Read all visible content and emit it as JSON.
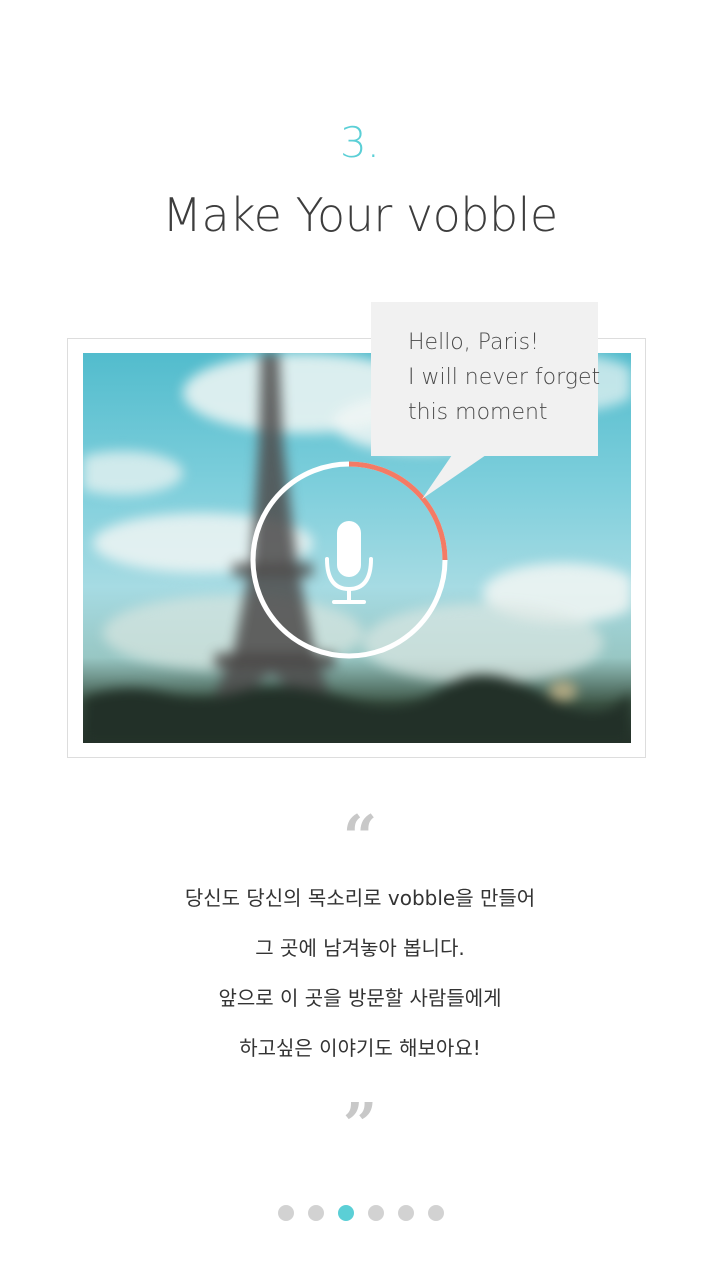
{
  "step": {
    "number": "3.",
    "title": "Make Your vobble"
  },
  "bubble": {
    "lines": [
      "Hello, Paris!",
      "I will never forget",
      "this moment"
    ]
  },
  "recorder": {
    "icon": "microphone-icon",
    "progress": 0.25,
    "progress_color": "#f47b65",
    "track_color": "#ffffff"
  },
  "quote": {
    "open": "“",
    "close": "”",
    "lines": [
      "당신도 당신의 목소리로 vobble을 만들어",
      "그 곳에 남겨놓아 봅니다.",
      "앞으로 이 곳을 방문할 사람들에게",
      "하고싶은 이야기도 해보아요!"
    ]
  },
  "pager": {
    "count": 6,
    "active_index": 2,
    "active_color": "#5bcfd6"
  },
  "colors": {
    "accent": "#5bcfd6",
    "text": "#3d3d3d",
    "quote_mark": "#c8c8c8"
  }
}
